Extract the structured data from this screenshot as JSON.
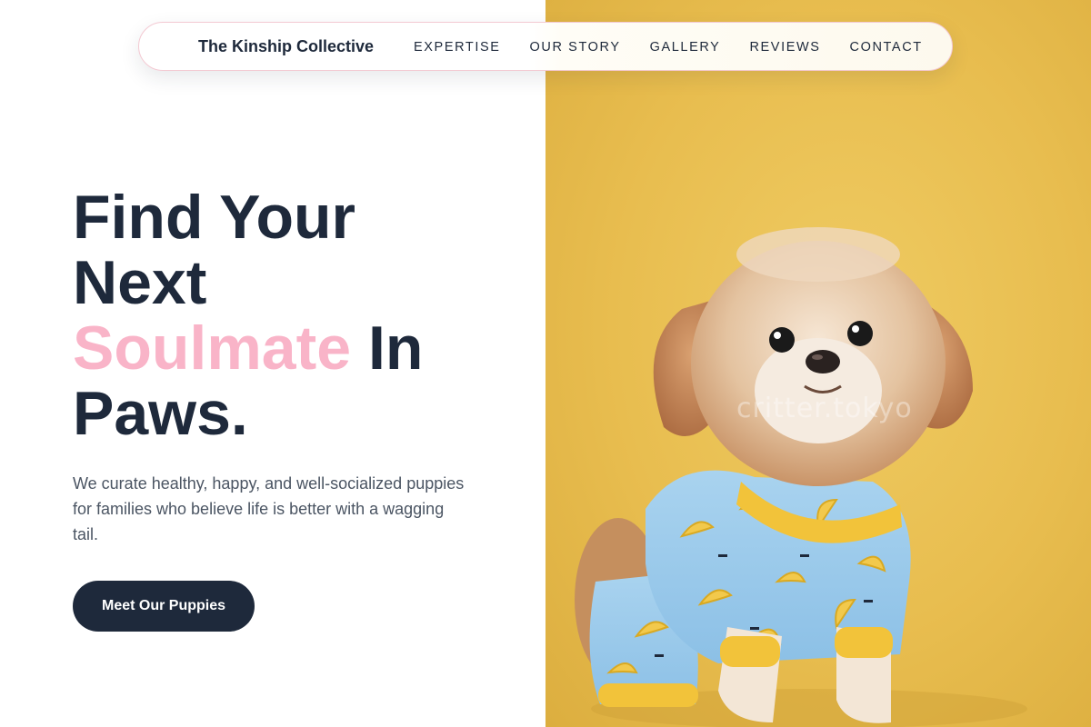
{
  "nav": {
    "brand": "The Kinship Collective",
    "links": [
      "EXPERTISE",
      "OUR STORY",
      "GALLERY",
      "REVIEWS",
      "CONTACT"
    ]
  },
  "hero": {
    "title_line1": "Find Your",
    "title_line2": "Next",
    "title_accent": "Soulmate",
    "title_after_accent": " In",
    "title_line4": "Paws.",
    "subtitle": "We curate healthy, happy, and well-socialized puppies for families who believe life is better with a wagging tail.",
    "cta_label": "Meet Our Puppies"
  },
  "photo": {
    "watermark": "critter.tokyo",
    "alt": "Small fluffy dog wearing blue banana-print pajamas on a yellow background"
  },
  "colors": {
    "primary": "#1e293b",
    "accent_pink": "#f9b4c8",
    "body_text": "#4b5563",
    "photo_background": "#e8bd4f"
  }
}
